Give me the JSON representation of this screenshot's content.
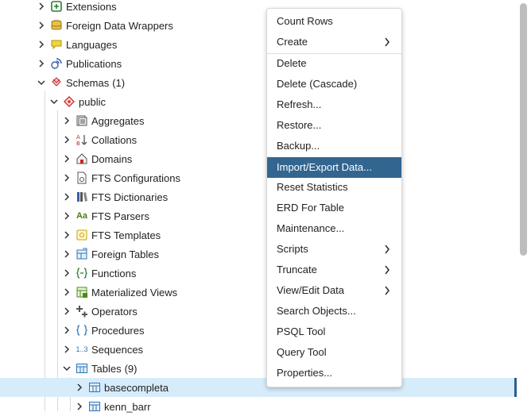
{
  "colors": {
    "menu_highlight": "#326690",
    "selected_row": "#d6ecfa",
    "text": "#222222"
  },
  "tree": {
    "items": [
      {
        "label": "Extensions",
        "icon": "extensions-icon"
      },
      {
        "label": "Foreign Data Wrappers",
        "icon": "foreign-data-wrappers-icon"
      },
      {
        "label": "Languages",
        "icon": "languages-icon"
      },
      {
        "label": "Publications",
        "icon": "publications-icon"
      },
      {
        "label": "Schemas",
        "count": "(1)",
        "icon": "schemas-icon",
        "expanded": true
      },
      {
        "label": "public",
        "icon": "schema-public-icon",
        "expanded": true
      },
      {
        "label": "Aggregates",
        "icon": "aggregates-icon"
      },
      {
        "label": "Collations",
        "icon": "collations-icon"
      },
      {
        "label": "Domains",
        "icon": "domains-icon"
      },
      {
        "label": "FTS Configurations",
        "icon": "fts-configurations-icon"
      },
      {
        "label": "FTS Dictionaries",
        "icon": "fts-dictionaries-icon"
      },
      {
        "label": "FTS Parsers",
        "icon": "fts-parsers-icon",
        "icon_text": "Aa"
      },
      {
        "label": "FTS Templates",
        "icon": "fts-templates-icon"
      },
      {
        "label": "Foreign Tables",
        "icon": "foreign-tables-icon"
      },
      {
        "label": "Functions",
        "icon": "functions-icon"
      },
      {
        "label": "Materialized Views",
        "icon": "materialized-views-icon"
      },
      {
        "label": "Operators",
        "icon": "operators-icon"
      },
      {
        "label": "Procedures",
        "icon": "procedures-icon"
      },
      {
        "label": "Sequences",
        "icon": "sequences-icon",
        "icon_text": "1..3"
      },
      {
        "label": "Tables",
        "count": "(9)",
        "icon": "tables-icon",
        "expanded": true
      },
      {
        "label": "basecompleta",
        "icon": "table-icon",
        "selected": true
      },
      {
        "label": "kenn_barr",
        "icon": "table-icon"
      }
    ]
  },
  "context_menu": {
    "items": [
      {
        "label": "Count Rows"
      },
      {
        "label": "Create",
        "submenu": true
      },
      {
        "label": "Delete"
      },
      {
        "label": "Delete (Cascade)"
      },
      {
        "label": "Refresh..."
      },
      {
        "label": "Restore..."
      },
      {
        "label": "Backup..."
      },
      {
        "label": "Import/Export Data...",
        "highlighted": true
      },
      {
        "label": "Reset Statistics"
      },
      {
        "label": "ERD For Table"
      },
      {
        "label": "Maintenance..."
      },
      {
        "label": "Scripts",
        "submenu": true
      },
      {
        "label": "Truncate",
        "submenu": true
      },
      {
        "label": "View/Edit Data",
        "submenu": true
      },
      {
        "label": "Search Objects..."
      },
      {
        "label": "PSQL Tool"
      },
      {
        "label": "Query Tool"
      },
      {
        "label": "Properties..."
      }
    ]
  }
}
